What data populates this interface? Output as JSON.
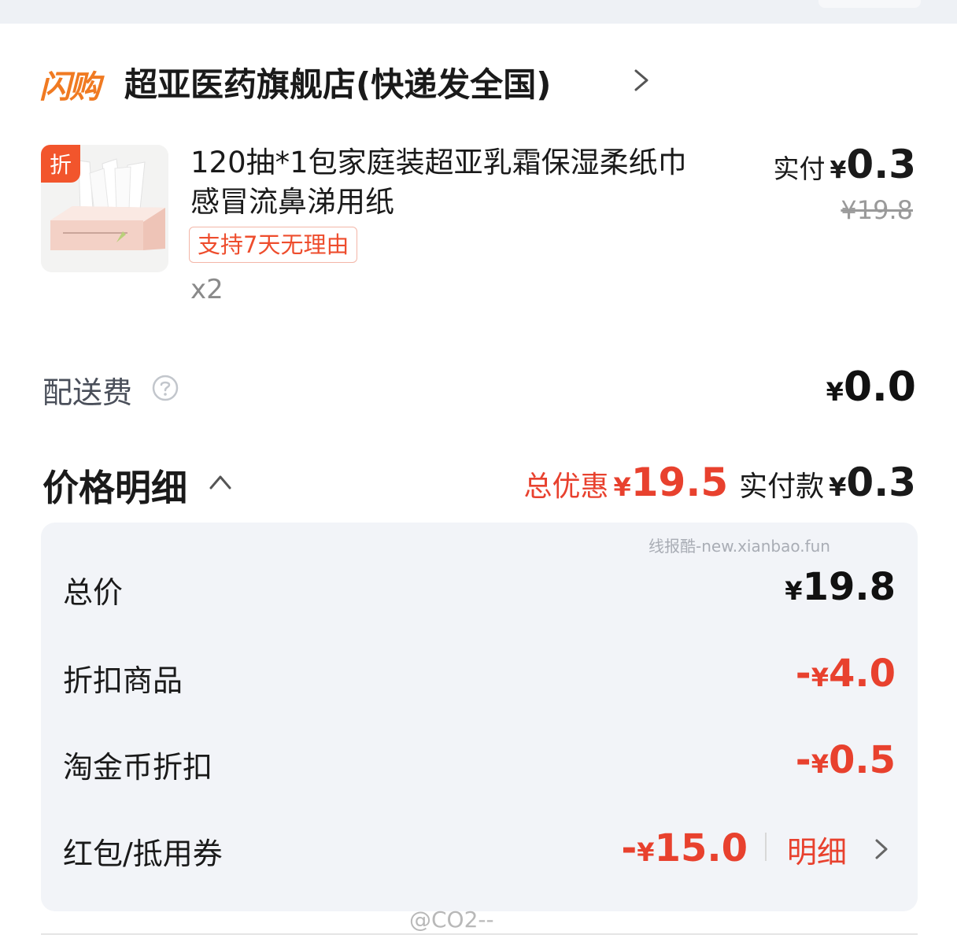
{
  "shop": {
    "logo_text": "闪购",
    "name": "超亚医药旗舰店(快递发全国)"
  },
  "product": {
    "discount_tag": "折",
    "title": "120抽*1包家庭装超亚乳霜保湿柔纸巾感冒流鼻涕用纸",
    "return_badge": "支持7天无理由",
    "quantity": "x2",
    "paid_label": "实付",
    "paid_currency": "¥",
    "paid_value": "0.3",
    "original_price": "¥19.8"
  },
  "shipping": {
    "label": "配送费",
    "currency": "¥",
    "value": "0.0"
  },
  "price_detail": {
    "title": "价格明细",
    "total_discount_label": "总优惠",
    "total_discount_currency": "¥",
    "total_discount_value": "19.5",
    "actual_paid_label": "实付款",
    "actual_paid_currency": "¥",
    "actual_paid_value": "0.3",
    "watermark": "线报酷-new.xianbao.fun",
    "rows": [
      {
        "label": "总价",
        "sign": "",
        "currency": "¥",
        "value": "19.8"
      },
      {
        "label": "折扣商品",
        "sign": "-",
        "currency": "¥",
        "value": "4.0"
      },
      {
        "label": "淘金币折扣",
        "sign": "-",
        "currency": "¥",
        "value": "0.5"
      },
      {
        "label": "红包/抵用券",
        "sign": "-",
        "currency": "¥",
        "value": "15.0",
        "link": "明细"
      }
    ]
  },
  "footer": {
    "weibo_mark": "@CO2--"
  },
  "colors": {
    "accent_red": "#e8412e",
    "logo_orange": "#f07a22",
    "panel_bg": "#f2f4f8"
  }
}
